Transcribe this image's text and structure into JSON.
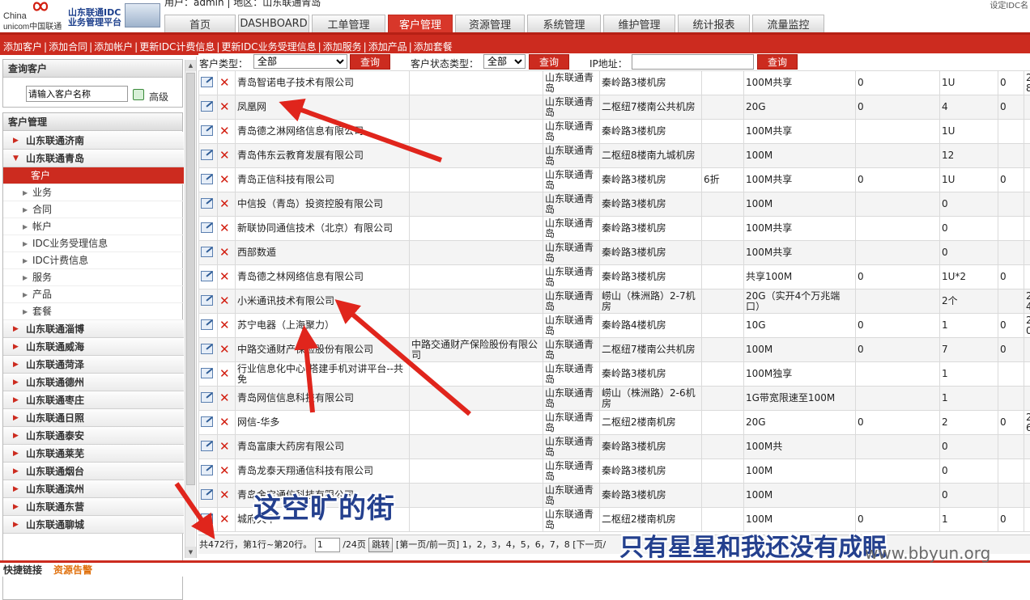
{
  "header": {
    "user_line": "用户：admin | 地区：山东联通青岛",
    "top_right": "设定IDC名",
    "logo_line1": "China",
    "logo_line2": "unicom中国联通",
    "logo_idc1": "山东联通IDC",
    "logo_idc2": "业务管理平台"
  },
  "nav": {
    "tabs": [
      {
        "label": "首页",
        "active": false
      },
      {
        "label": "DASHBOARD",
        "active": false
      },
      {
        "label": "工单管理",
        "active": false
      },
      {
        "label": "客户管理",
        "active": true
      },
      {
        "label": "资源管理",
        "active": false
      },
      {
        "label": "系统管理",
        "active": false
      },
      {
        "label": "维护管理",
        "active": false
      },
      {
        "label": "统计报表",
        "active": false
      },
      {
        "label": "流量监控",
        "active": false
      }
    ]
  },
  "actions": [
    "添加客户",
    "添加合同",
    "添加帐户",
    "更新IDC计费信息",
    "更新IDC业务受理信息",
    "添加服务",
    "添加产品",
    "添加套餐"
  ],
  "sidebar": {
    "query_title": "查询客户",
    "query_placeholder": "请输入客户名称",
    "query_advanced": "高级",
    "mgr_title": "客户管理",
    "top_groups": [
      {
        "label": "山东联通济南",
        "expanded": false
      },
      {
        "label": "山东联通青岛",
        "expanded": true
      }
    ],
    "sub_items": [
      {
        "label": "客户",
        "active": true
      },
      {
        "label": "业务",
        "active": false
      },
      {
        "label": "合同",
        "active": false
      },
      {
        "label": "帐户",
        "active": false
      },
      {
        "label": "IDC业务受理信息",
        "active": false
      },
      {
        "label": "IDC计费信息",
        "active": false
      },
      {
        "label": "服务",
        "active": false
      },
      {
        "label": "产品",
        "active": false
      },
      {
        "label": "套餐",
        "active": false
      }
    ],
    "bottom_groups": [
      "山东联通淄博",
      "山东联通威海",
      "山东联通菏泽",
      "山东联通德州",
      "山东联通枣庄",
      "山东联通日照",
      "山东联通泰安",
      "山东联通莱芜",
      "山东联通烟台",
      "山东联通滨州",
      "山东联通东营",
      "山东联通聊城"
    ]
  },
  "filter": {
    "type_label": "客户类型：",
    "type_value": "全部",
    "query": "查询",
    "status_label": "客户状态类型：",
    "status_value": "全部",
    "ip_label": "IP地址："
  },
  "rows": [
    [
      "青岛智诺电子技术有限公司",
      "",
      "山东联通青岛",
      "秦岭路3楼机房",
      "",
      "100M共享",
      "0",
      "1U",
      "0",
      "2013-0 08:55"
    ],
    [
      "凤凰网",
      "",
      "山东联通青岛",
      "二枢纽7楼南公共机房",
      "",
      "20G",
      "0",
      "4",
      "0",
      ""
    ],
    [
      "青岛德之淋网络信息有限公司",
      "",
      "山东联通青岛",
      "秦岭路3楼机房",
      "",
      "100M共享",
      "",
      "1U",
      "",
      ""
    ],
    [
      "青岛伟东云教育发展有限公司",
      "",
      "山东联通青岛",
      "二枢纽8楼南九城机房",
      "",
      "100M",
      "",
      "12",
      "",
      ""
    ],
    [
      "青岛正信科技有限公司",
      "",
      "山东联通青岛",
      "秦岭路3楼机房",
      "6折",
      "100M共享",
      "0",
      "1U",
      "0",
      ""
    ],
    [
      "中信投（青岛）投资控股有限公司",
      "",
      "山东联通青岛",
      "秦岭路3楼机房",
      "",
      "100M",
      "",
      "0",
      "",
      ""
    ],
    [
      "新联协同通信技术（北京）有限公司",
      "",
      "山东联通青岛",
      "秦岭路3楼机房",
      "",
      "100M共享",
      "",
      "0",
      "",
      ""
    ],
    [
      "西部数遁",
      "",
      "山东联通青岛",
      "秦岭路3楼机房",
      "",
      "100M共享",
      "",
      "0",
      "",
      ""
    ],
    [
      "青岛德之林网络信息有限公司",
      "",
      "山东联通青岛",
      "秦岭路3楼机房",
      "",
      "共享100M",
      "0",
      "1U*2",
      "0",
      ""
    ],
    [
      "小米通讯技术有限公司",
      "",
      "山东联通青岛",
      "崂山（株洲路）2-7机房",
      "",
      "20G（实开4个万兆端口）",
      "",
      "2个",
      "",
      "2014-1 14:52"
    ],
    [
      "苏宁电器（上海聚力）",
      "",
      "山东联通青岛",
      "秦岭路4楼机房",
      "",
      "10G",
      "0",
      "1",
      "0",
      "2014-1 10:11"
    ],
    [
      "中路交通财产保险股份有限公司",
      "中路交通财产保险股份有限公司",
      "山东联通青岛",
      "二枢纽7楼南公共机房",
      "",
      "100M",
      "0",
      "7",
      "0",
      ""
    ],
    [
      "行业信息化中心-搭建手机对讲平台--共免",
      "",
      "山东联通青岛",
      "秦岭路3楼机房",
      "",
      "100M独享",
      "",
      "1",
      "",
      ""
    ],
    [
      "青岛网信信息科技有限公司",
      "",
      "山东联通青岛",
      "崂山（株洲路）2-6机房",
      "",
      "1G带宽限速至100M",
      "",
      "1",
      "",
      ""
    ],
    [
      "网信-华多",
      "",
      "山东联通青岛",
      "二枢纽2楼南机房",
      "",
      "20G",
      "0",
      "2",
      "0",
      "2014-0 16:27"
    ],
    [
      "青岛富康大药房有限公司",
      "",
      "山东联通青岛",
      "秦岭路3楼机房",
      "",
      "100M共",
      "",
      "0",
      "",
      ""
    ],
    [
      "青岛龙泰天翔通信科技有限公司",
      "",
      "山东联通青岛",
      "秦岭路3楼机房",
      "",
      "100M",
      "",
      "0",
      "",
      ""
    ],
    [
      "青岛金宝通信科技有限公司",
      "",
      "山东联通青岛",
      "秦岭路3楼机房",
      "",
      "100M",
      "",
      "0",
      "",
      ""
    ],
    [
      "城府天下",
      "",
      "山东联通青岛",
      "二枢纽2楼南机房",
      "",
      "100M",
      "0",
      "1",
      "0",
      ""
    ]
  ],
  "pager": {
    "summary": "共472行，第1行~第20行。",
    "page_value": "1",
    "total_pages": "/24页",
    "jump": "跳转",
    "nav_prefix": "[第一页/前一页]",
    "pages": "1，2，3，4，5，6，7，8",
    "nav_suffix": "[下一页/"
  },
  "footer": {
    "quick_links": "快捷链接",
    "alarm": "资源告警"
  },
  "overlay": {
    "text1": "这空旷的街",
    "text2": "只有星星和我还没有成眠",
    "watermark": "www.bbyun.org"
  },
  "colors": {
    "accent": "#cc2b1f",
    "overlay_text": "#24408e",
    "arrow": "#e0251c"
  }
}
